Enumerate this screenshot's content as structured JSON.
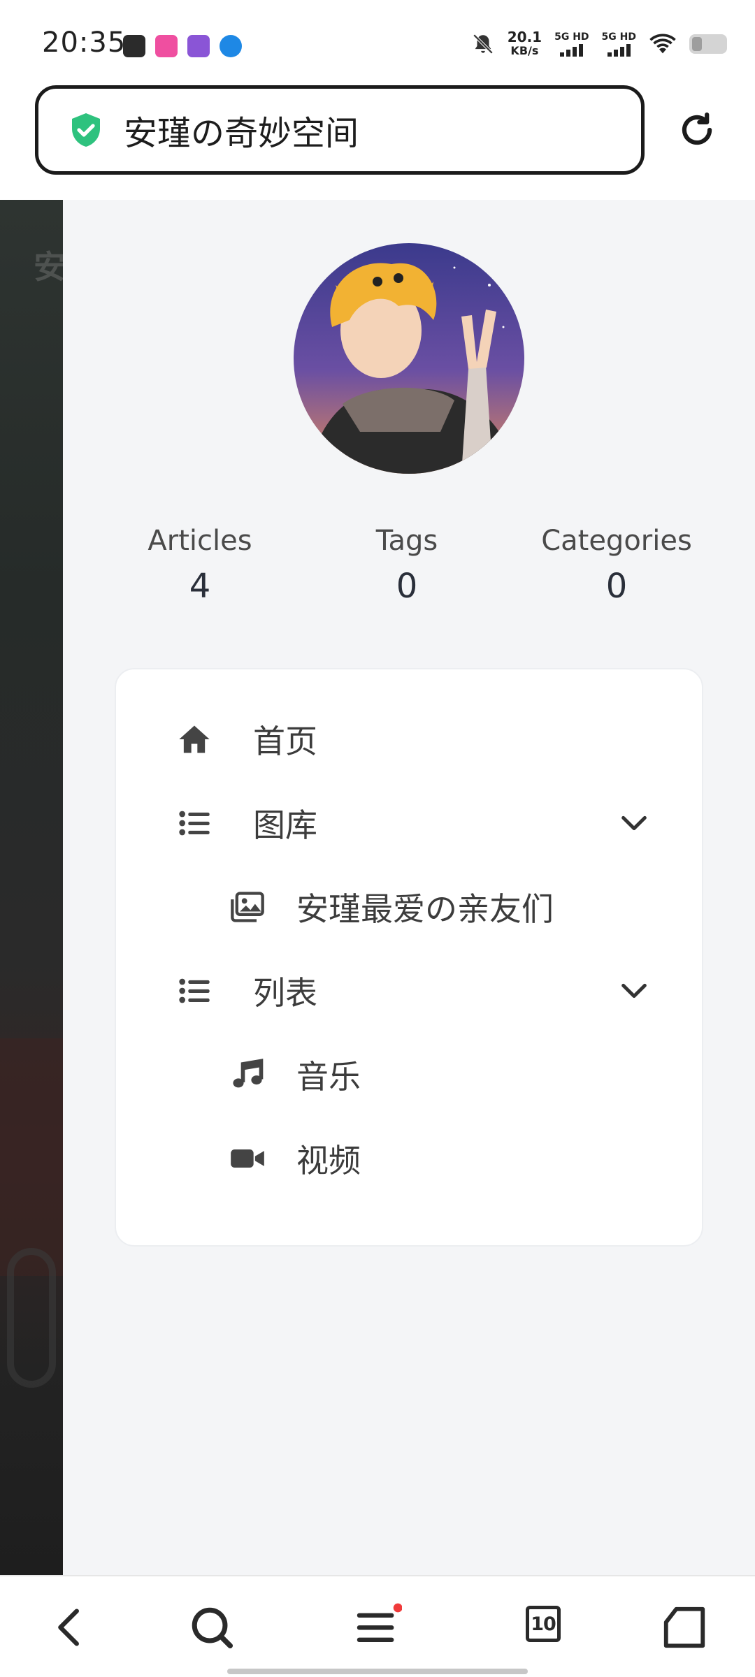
{
  "status_bar": {
    "time": "20:35",
    "net_speed_value": "20.1",
    "net_speed_unit": "KB/s",
    "sim1_label": "5G HD",
    "sim2_label": "5G HD"
  },
  "address_bar": {
    "title": "安瑾の奇妙空间"
  },
  "background_page": {
    "ghost_text": "安"
  },
  "profile": {
    "stats": [
      {
        "label": "Articles",
        "value": "4"
      },
      {
        "label": "Tags",
        "value": "0"
      },
      {
        "label": "Categories",
        "value": "0"
      }
    ]
  },
  "menu": {
    "items": [
      {
        "label": "首页",
        "icon": "home-icon"
      },
      {
        "label": "图库",
        "icon": "list-icon",
        "expanded": true
      },
      {
        "label": "安瑾最爱の亲友们",
        "icon": "images-icon"
      },
      {
        "label": "列表",
        "icon": "list-icon",
        "expanded": true
      },
      {
        "label": "音乐",
        "icon": "music-icon"
      },
      {
        "label": "视频",
        "icon": "video-icon"
      }
    ]
  },
  "bottom_nav": {
    "tabs_count": "10"
  },
  "colors": {
    "shield": "#2ec27e",
    "panel_bg": "#f4f5f7",
    "notification_dot": "#f03a3a"
  }
}
